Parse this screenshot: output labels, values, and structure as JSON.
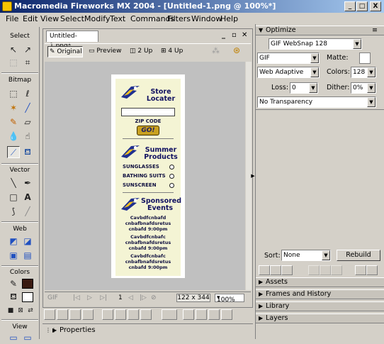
{
  "window": {
    "title": "Macromedia Fireworks MX 2004 - [Untitled-1.png @ 100%*]",
    "controls": [
      "_",
      "□",
      "X"
    ]
  },
  "menu": [
    "File",
    "Edit",
    "View",
    "Select",
    "Modify",
    "Text",
    "Commands",
    "Filters",
    "Window",
    "Help"
  ],
  "tools": {
    "sections": [
      "Select",
      "Bitmap",
      "Vector",
      "Web",
      "Colors",
      "View"
    ]
  },
  "document": {
    "tab_label": "Untitled-1.png*",
    "views": [
      "Original",
      "Preview",
      "2 Up",
      "4 Up"
    ],
    "page_counter": "1",
    "size": "122 x 344",
    "zoom": "100%"
  },
  "webpage": {
    "store_locator": [
      "Store",
      "Locater"
    ],
    "zip_code_label": "ZIP CODE",
    "go_button": "GO!",
    "summer_products": [
      "Summer",
      "Products"
    ],
    "products": [
      "SUNGLASSES",
      "BATHING SUITS",
      "SUNSCREEN"
    ],
    "sponsored_events": [
      "Sponsored",
      "Events"
    ],
    "event_lines": [
      "Cavbdfcnbafd",
      "cnbafbnafdsretus",
      "cnbafd 9:00pm",
      "Cavbdfcnbafc",
      "cnbafbnafdsretus",
      "cnbafd 9:00pm",
      "Cavbdfcnbafc",
      "cnbafbnafdsretus",
      "cnbafd 9:00pm"
    ]
  },
  "properties_label": "Properties",
  "optimize": {
    "header": "Optimize",
    "preset": "GIF WebSnap 128",
    "format": "GIF",
    "matte_label": "Matte:",
    "palette": "Web Adaptive",
    "colors_label": "Colors:",
    "colors_value": "128",
    "loss_label": "Loss:",
    "loss_value": "0",
    "dither_label": "Dither:",
    "dither_value": "0%",
    "transparency": "No Transparency",
    "sort_label": "Sort:",
    "sort_value": "None",
    "rebuild_label": "Rebuild"
  },
  "panels": [
    "Assets",
    "Frames and History",
    "Library",
    "Layers"
  ],
  "colors": {
    "titlebar_start": "#0a246a",
    "titlebar_end": "#a6caf0",
    "chrome": "#d4d0c8",
    "canvas_bg": "#c0c0c0",
    "webpage_bg": "#f4f4d4",
    "go_button": "#c8a020",
    "stroke_color": "#3a1a10"
  }
}
